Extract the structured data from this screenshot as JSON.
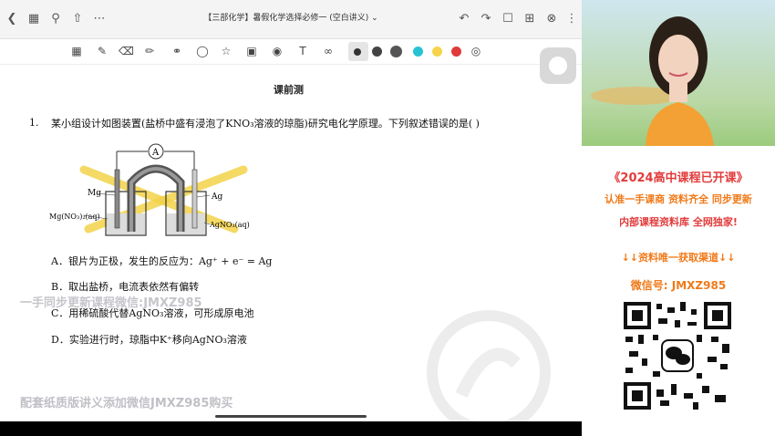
{
  "topbar": {
    "title": "【三部化学】暑假化学选择必修一 (空白讲义) ⌄",
    "back_icon": "chevron-left-icon",
    "colors": {
      "bar": "#f4f4f5",
      "accent_red": "#e23b3b",
      "accent_orange": "#f07a1a"
    }
  },
  "toolbar": {
    "pen_colors": [
      "#333333",
      "#444444",
      "#555555",
      "#27c3d3",
      "#f6d44a",
      "#e03a3a"
    ]
  },
  "doc": {
    "heading": "课前测",
    "question_number": "1.",
    "question_text": "某小组设计如图装置(盐桥中盛有浸泡了KNO₃溶液的琼脂)研究电化学原理。下列叙述错误的是(     )",
    "diagram_labels": {
      "ammeter": "A",
      "mg": "Mg",
      "ag": "Ag",
      "mg_solution": "Mg(NO₃)₂(aq)",
      "ag_solution": "AgNO₃(aq)"
    },
    "options": [
      "A．银片为正极，发生的反应为：Ag⁺ + e⁻ = Ag",
      "B．取出盐桥，电流表依然有偏转",
      "C．用稀硫酸代替AgNO₃溶液，可形成原电池",
      "D．实验进行时，琼脂中K⁺移向AgNO₃溶液"
    ],
    "watermark_1": "一手同步更新课程微信:JMXZ985",
    "watermark_2": "配套纸质版讲义添加微信JMXZ985购买"
  },
  "promo": {
    "line1": "《2024高中课程已开课》",
    "line2": "认准一手课商  资料齐全  同步更新",
    "line3": "内部课程资料库  全网独家!",
    "line4": "↓↓资料唯一获取渠道↓↓",
    "line5": "微信号: JMXZ985"
  }
}
